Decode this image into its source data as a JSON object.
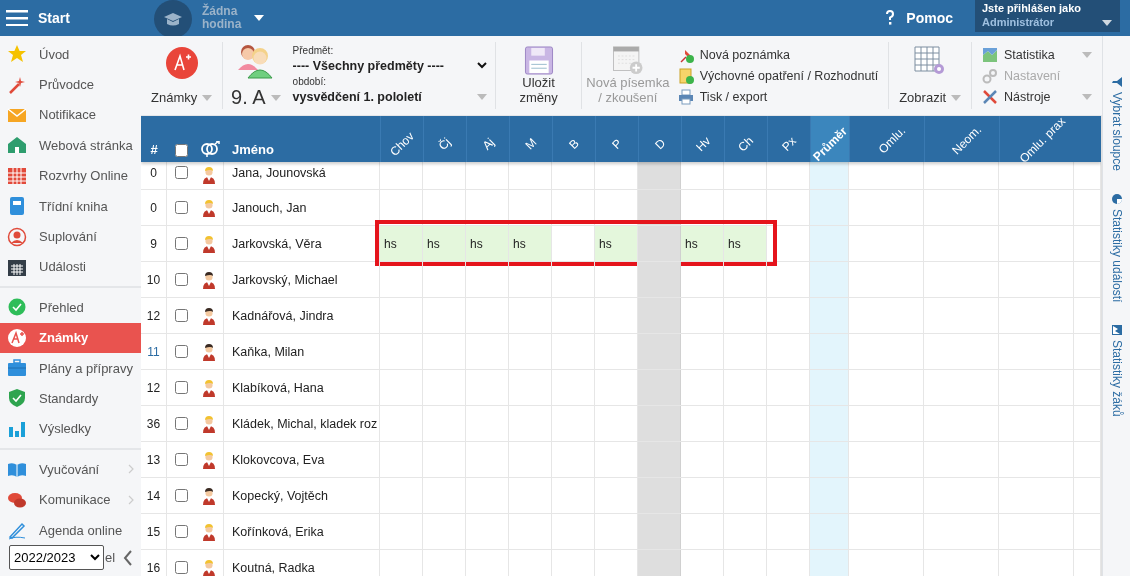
{
  "top_bar": {
    "menu_label": "Start",
    "lesson": "Žádna hodina",
    "help": "Pomoc",
    "user_caption": "Jste přihlášen jako",
    "user_role": "Administrátor"
  },
  "sidebar": {
    "sections": [
      [
        {
          "label": "Úvod",
          "selected": false
        },
        {
          "label": "Průvodce",
          "selected": false
        },
        {
          "label": "Notifikace",
          "selected": false
        },
        {
          "label": "Webová stránka",
          "selected": false
        },
        {
          "label": "Rozvrhy Online",
          "selected": false
        },
        {
          "label": "Třídní kniha",
          "selected": false
        },
        {
          "label": "Suplování",
          "selected": false
        },
        {
          "label": "Události",
          "selected": false
        }
      ],
      [
        {
          "label": "Přehled",
          "selected": false
        },
        {
          "label": "Známky",
          "selected": true
        },
        {
          "label": "Plány a přípravy",
          "selected": false
        },
        {
          "label": "Standardy",
          "selected": false
        },
        {
          "label": "Výsledky",
          "selected": false
        }
      ],
      [
        {
          "label": "Vyučování",
          "selected": false,
          "submenu": true
        },
        {
          "label": "Komunikace",
          "selected": false,
          "submenu": true
        },
        {
          "label": "Agenda online",
          "selected": false,
          "submenu": false
        }
      ]
    ],
    "year": "2022/2023",
    "hidden_label": "el"
  },
  "toolbar": {
    "module": "Známky",
    "class_name": "9. A",
    "subject_label": "Předmět:",
    "subject": "---- Všechny předměty ----",
    "period_label": "období:",
    "period": "vysvědčení 1. pololetí",
    "save": "Uložit změny",
    "new_test": {
      "label": "Nová písemka / zkoušení",
      "disabled": true
    },
    "actions": [
      "Nová poznámka",
      "Výchovné opatření / Rozhodnutí",
      "Tisk / export"
    ],
    "view": "Zobrazit",
    "tools": [
      {
        "label": "Statistika",
        "disabled": false,
        "dropdown": true
      },
      {
        "label": "Nastavení",
        "disabled": true,
        "dropdown": false
      },
      {
        "label": "Nástroje",
        "disabled": false,
        "dropdown": true
      }
    ]
  },
  "table": {
    "columns_fixed": [
      "#",
      "Jméno"
    ],
    "select_all": {
      "checked": false
    },
    "columns": [
      {
        "label": "Chov",
        "kind": "subject",
        "disabled": false
      },
      {
        "label": "Čj",
        "kind": "subject",
        "disabled": false
      },
      {
        "label": "Aj",
        "kind": "subject",
        "disabled": false
      },
      {
        "label": "M",
        "kind": "subject",
        "disabled": false
      },
      {
        "label": "B",
        "kind": "subject",
        "disabled": false
      },
      {
        "label": "P",
        "kind": "subject",
        "disabled": false
      },
      {
        "label": "D",
        "kind": "subject",
        "disabled": true
      },
      {
        "label": "Hv",
        "kind": "subject",
        "disabled": false
      },
      {
        "label": "Ch",
        "kind": "subject",
        "disabled": false
      },
      {
        "label": "Px",
        "kind": "subject",
        "disabled": false
      },
      {
        "label": "Průměr",
        "kind": "average",
        "disabled": false
      },
      {
        "label": "Omlu.",
        "kind": "absence",
        "disabled": false
      },
      {
        "label": "Neom.",
        "kind": "absence",
        "disabled": false
      },
      {
        "label": "Omlu. prax",
        "kind": "absence",
        "disabled": false
      }
    ],
    "rows": [
      {
        "number": "0",
        "highlighted": false,
        "checked": false,
        "kind": "female",
        "name": "Jana, Jounovská"
      },
      {
        "number": "0",
        "highlighted": false,
        "checked": false,
        "kind": "female",
        "name": "Janouch, Jan"
      },
      {
        "number": "9",
        "highlighted": false,
        "checked": false,
        "kind": "female",
        "name": "Jarkovská, Věra",
        "marked": true,
        "grades": [
          {
            "filled": true,
            "value": "hs"
          },
          {
            "filled": true,
            "value": "hs"
          },
          {
            "filled": true,
            "value": "hs"
          },
          {
            "filled": true,
            "value": "hs"
          },
          {
            "filled": false
          },
          {
            "filled": true,
            "value": "hs"
          },
          {
            "filled": false
          },
          {
            "filled": true,
            "value": "hs"
          },
          {
            "filled": true,
            "value": "hs"
          },
          {
            "filled": false
          }
        ]
      },
      {
        "number": "10",
        "highlighted": false,
        "checked": false,
        "kind": "male",
        "name": "Jarkovský, Michael"
      },
      {
        "number": "12",
        "highlighted": false,
        "checked": false,
        "kind": "male",
        "name": "Kadnářová, Jindra"
      },
      {
        "number": "11",
        "highlighted": true,
        "checked": false,
        "kind": "male",
        "name": "Kaňka, Milan"
      },
      {
        "number": "12",
        "highlighted": false,
        "checked": false,
        "kind": "female",
        "name": "Klabíková, Hana"
      },
      {
        "number": "36",
        "highlighted": false,
        "checked": false,
        "kind": "female",
        "name": "Kládek, Michal, kladek roz"
      },
      {
        "number": "13",
        "highlighted": false,
        "checked": false,
        "kind": "female",
        "name": "Klokovcova, Eva"
      },
      {
        "number": "14",
        "highlighted": false,
        "checked": false,
        "kind": "male",
        "name": "Kopecký, Vojtěch"
      },
      {
        "number": "15",
        "highlighted": false,
        "checked": false,
        "kind": "female",
        "name": "Kořínková, Erika"
      },
      {
        "number": "16",
        "highlighted": false,
        "checked": false,
        "kind": "female",
        "name": "Koutná, Radka"
      }
    ]
  },
  "right_panel": [
    "Vybrat sloupce",
    "Statistiky událostí",
    "Statistiky žáků"
  ]
}
